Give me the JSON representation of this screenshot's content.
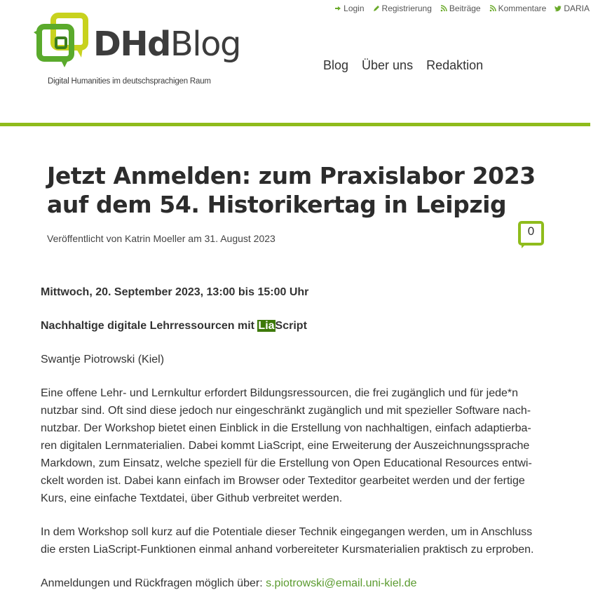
{
  "topbar": {
    "items": [
      {
        "label": "Login",
        "icon": "login-icon"
      },
      {
        "label": "Registrierung",
        "icon": "pencil-icon"
      },
      {
        "label": "Beiträge",
        "icon": "rss-icon"
      },
      {
        "label": "Kommentare",
        "icon": "rss-icon"
      },
      {
        "label": "DARIA",
        "icon": "twitter-icon"
      }
    ],
    "icon_color": "#6aaa2a"
  },
  "logo": {
    "name_bold": "DHd",
    "name_regular": "Blog",
    "tagline": "Digital Humanities im deutschsprachigen Raum",
    "colors": {
      "green": "#5aaa2c",
      "yellow": "#c8d21e",
      "dark": "#3c3c3c"
    }
  },
  "nav": {
    "items": [
      "Blog",
      "Über uns",
      "Redaktion"
    ]
  },
  "accent_color": "#8fbc1c",
  "article": {
    "title": "Jetzt Anmelden: zum Praxislabor 2023 auf dem 54. Historikertag in Leipzig",
    "meta": "Veröffentlicht von Katrin Moeller am 31. August 2023",
    "comment_count": "0",
    "date_line": "Mittwoch, 20. September 2023, 13:00 bis 15:00 Uhr",
    "subtitle_prefix": "Nachhaltige digitale Lehrressourcen mit ",
    "subtitle_highlight": "Lia",
    "subtitle_suffix": "Script",
    "author_line": "Swantje Piotrowski (Kiel)",
    "paragraph1_lines": [
      "Eine offene Lehr- und Lernkultur erfordert Bildungsressourcen, die frei zugänglich und für jede*n",
      "nutzbar sind. Oft sind diese jedoch nur eingeschränkt zugänglich und mit spezieller Software nach-",
      "nutzbar. Der Workshop bietet einen Einblick in die Erstellung von nachhaltigen, einfach adaptierba-",
      "ren digitalen Lernmaterialien. Dabei kommt LiaScript, eine Erweiterung der Auszeichnungssprache",
      "Markdown, zum Einsatz, welche speziell für die Erstellung von Open Educational Resources entwi-",
      "ckelt worden ist. Dabei kann einfach im Browser oder Texteditor gearbeitet werden und der fertige",
      "Kurs, eine einfache Textdatei, über Github verbreitet werden."
    ],
    "paragraph2_lines": [
      "In dem Workshop soll kurz auf die Potentiale dieser Technik eingegangen werden, um in Anschluss",
      "die ersten LiaScript-Funktionen einmal anhand vorbereiteter Kursmaterialien praktisch zu erproben."
    ],
    "contact_prefix": "Anmeldungen und Rückfragen möglich über: ",
    "contact_email": "s.piotrowski@email.uni-kiel.de"
  }
}
